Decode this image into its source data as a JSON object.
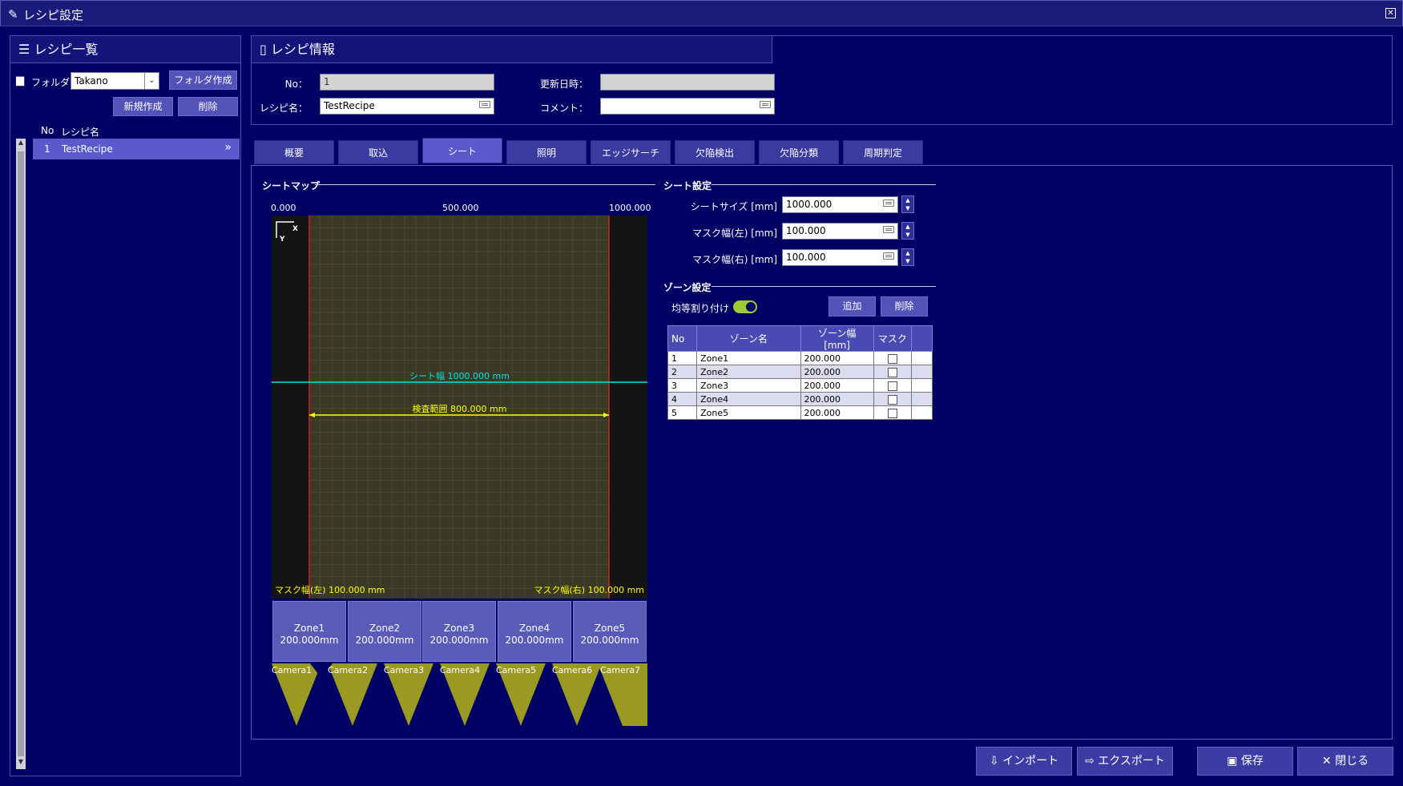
{
  "window": {
    "title": "レシピ設定",
    "icon": "edit-icon",
    "close_symbol": "✕"
  },
  "recipe_list": {
    "heading": "レシピ一覧",
    "folder_label": "フォルダ：",
    "folder_value": "Takano",
    "create_folder_button": "フォルダ作成",
    "new_button": "新規作成",
    "delete_button": "削除",
    "col_no": "No",
    "col_name": "レシピ名",
    "items": [
      {
        "no": "1",
        "name": "TestRecipe",
        "arrow": "»"
      }
    ]
  },
  "recipe_info": {
    "heading": "レシピ情報",
    "no_label": "No：",
    "no_value": "1",
    "name_label": "レシピ名：",
    "name_value": "TestRecipe",
    "updated_label": "更新日時：",
    "updated_value": "",
    "comment_label": "コメント：",
    "comment_value": ""
  },
  "tabs": [
    "概要",
    "取込",
    "シート",
    "照明",
    "エッジサーチ",
    "欠陥検出",
    "欠陥分類",
    "周期判定"
  ],
  "active_tab": "シート",
  "sheet_map": {
    "title": "シートマップ",
    "scale": [
      "0.000",
      "500.000",
      "1000.000"
    ],
    "axis_x": "X",
    "axis_y": "Y",
    "sheet_width_label": "シート幅 1000.000 mm",
    "inspect_label": "検査範囲 800.000 mm",
    "mask_left_label": "マスク幅(左) 100.000 mm",
    "mask_right_label": "マスク幅(右) 100.000 mm",
    "zones": [
      {
        "name": "Zone1",
        "width": "200.000mm"
      },
      {
        "name": "Zone2",
        "width": "200.000mm"
      },
      {
        "name": "Zone3",
        "width": "200.000mm"
      },
      {
        "name": "Zone4",
        "width": "200.000mm"
      },
      {
        "name": "Zone5",
        "width": "200.000mm"
      }
    ],
    "cameras": [
      "Camera1",
      "Camera2",
      "Camera3",
      "Camera4",
      "Camera5",
      "Camera6",
      "Camera7"
    ]
  },
  "sheet_settings": {
    "title": "シート設定",
    "size_label": "シートサイズ [mm]",
    "size_value": "1000.000",
    "mask_left_label": "マスク幅(左) [mm]",
    "mask_left_value": "100.000",
    "mask_right_label": "マスク幅(右) [mm]",
    "mask_right_value": "100.000"
  },
  "zone_settings": {
    "title": "ゾーン設定",
    "equal_label": "均等割り付け",
    "equal_on": true,
    "add_button": "追加",
    "delete_button": "削除",
    "columns": [
      "No",
      "ゾーン名",
      "ゾーン幅 [mm]",
      "マスク"
    ],
    "rows": [
      {
        "no": "1",
        "name": "Zone1",
        "width": "200.000"
      },
      {
        "no": "2",
        "name": "Zone2",
        "width": "200.000"
      },
      {
        "no": "3",
        "name": "Zone3",
        "width": "200.000"
      },
      {
        "no": "4",
        "name": "Zone4",
        "width": "200.000"
      },
      {
        "no": "5",
        "name": "Zone5",
        "width": "200.000"
      }
    ]
  },
  "footer": {
    "import": "インポート",
    "export": "エクスポート",
    "save": "保存",
    "close": "閉じる"
  },
  "colors": {
    "background": "#000064",
    "accent": "#5a5acc",
    "sheet_line": "#00e5e5",
    "inspect_line": "#ffff00",
    "mask_line": "#cc2222"
  }
}
